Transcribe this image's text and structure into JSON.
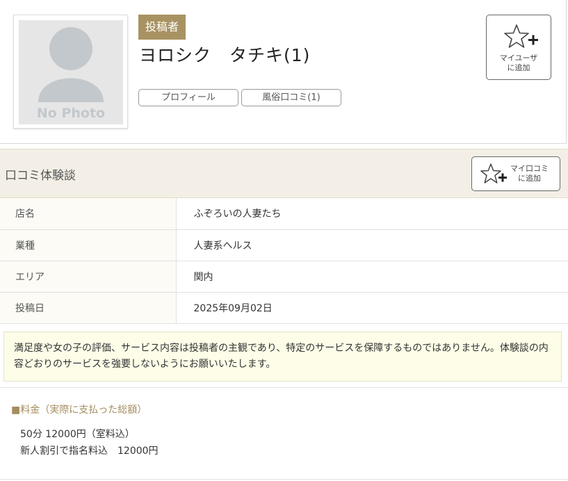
{
  "profile": {
    "avatar_text": "No Photo",
    "badge": "投稿者",
    "name": "ヨロシク　タチキ(1)",
    "buttons": {
      "profile": "プロフィール",
      "reviews": "風俗口コミ(1)"
    },
    "my_user_button": {
      "icon": "star-plus-icon",
      "line1": "マイユーザ",
      "line2": "に追加"
    }
  },
  "review": {
    "title": "口コミ体験談",
    "my_review_button": {
      "icon": "star-plus-icon",
      "line1": "マイ口コミ",
      "line2": "に追加"
    },
    "rows": [
      {
        "label": "店名",
        "value": "ふぞろいの人妻たち"
      },
      {
        "label": "業種",
        "value": "人妻系ヘルス"
      },
      {
        "label": "エリア",
        "value": "関内"
      },
      {
        "label": "投稿日",
        "value": "2025年09月02日"
      }
    ],
    "notice": "満足度や女の子の評価、サービス内容は投稿者の主観であり、特定のサービスを保障するものではありません。体験談の内容どおりのサービスを強要しないようにお願いいたします。"
  },
  "price": {
    "title": "■料金（実際に支払った総額）",
    "line1": "50分 12000円（室料込）",
    "line2": "新人割引で指名料込　12000円"
  },
  "colors": {
    "accent": "#a99262",
    "header_bg": "#f3efe6",
    "notice_bg": "#fdfde8"
  }
}
